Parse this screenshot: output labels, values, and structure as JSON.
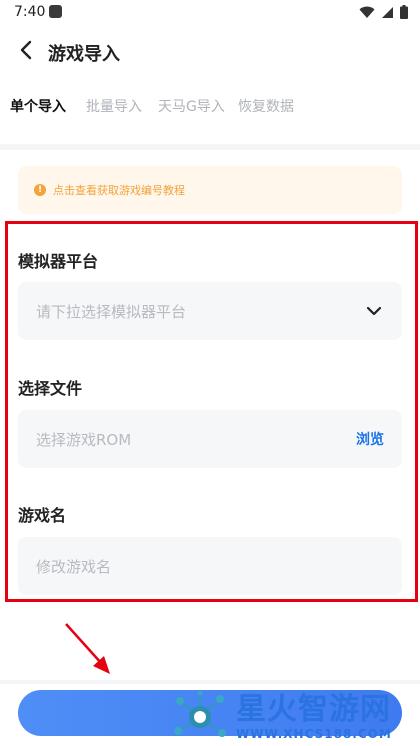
{
  "status_bar": {
    "time": "7:40"
  },
  "header": {
    "title": "游戏导入"
  },
  "tabs": [
    {
      "label": "单个导入",
      "active": true
    },
    {
      "label": "批量导入",
      "active": false
    },
    {
      "label": "天马G导入",
      "active": false
    },
    {
      "label": "恢复数据",
      "active": false
    }
  ],
  "notice": {
    "icon": "info-icon",
    "text": "点击查看获取游戏编号教程"
  },
  "form": {
    "platform": {
      "label": "模拟器平台",
      "placeholder": "请下拉选择模拟器平台"
    },
    "file": {
      "label": "选择文件",
      "placeholder": "选择游戏ROM",
      "browse_label": "浏览"
    },
    "name": {
      "label": "游戏名",
      "placeholder": "修改游戏名"
    }
  },
  "watermark": {
    "main": "星火智游网",
    "sub": "WWW.XHCS188.COM"
  },
  "colors": {
    "accent": "#1a73e8",
    "warning": "#f2a33a",
    "highlight": "#e50012",
    "button": "#4f8ef7"
  }
}
